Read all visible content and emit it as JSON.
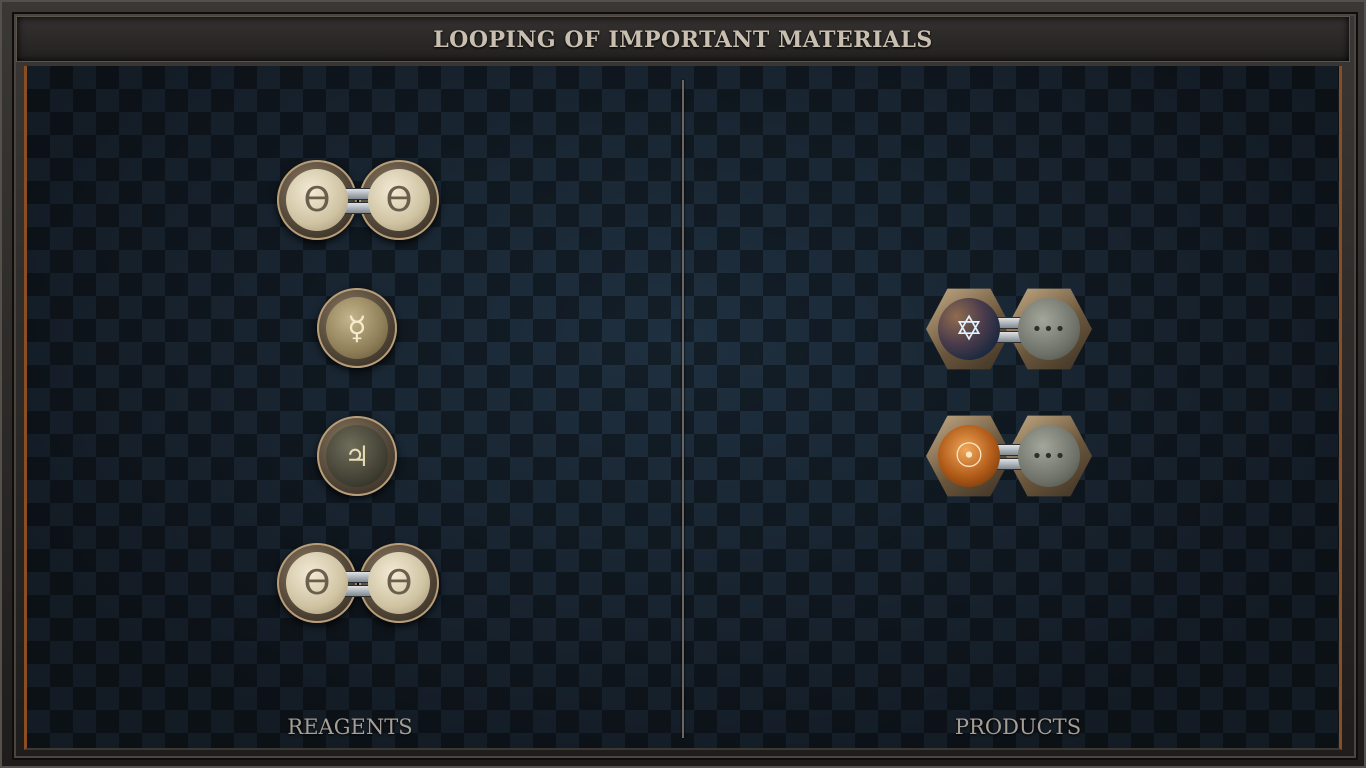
{
  "title": "LOOPING OF IMPORTANT MATERIALS",
  "columns": {
    "reagents_label": "REAGENTS",
    "products_label": "PRODUCTS"
  },
  "reagents": [
    {
      "type": "bonded-pair",
      "left_symbol": "ϴ",
      "right_symbol": "ϴ",
      "icon_names": [
        "salt-icon",
        "salt-icon"
      ]
    },
    {
      "type": "single",
      "symbol": "☿",
      "icon_name": "quicksilver-icon"
    },
    {
      "type": "single",
      "symbol": "♃",
      "icon_name": "jupiter-icon"
    },
    {
      "type": "bonded-pair",
      "left_symbol": "ϴ",
      "right_symbol": "ϴ",
      "icon_names": [
        "salt-icon",
        "salt-icon"
      ]
    }
  ],
  "products": [
    {
      "type": "bonded-pair",
      "left_symbol": "✡",
      "right_symbol": "•••",
      "icon_names": [
        "hexagram-icon",
        "ellipsis-icon"
      ]
    },
    {
      "type": "bonded-pair",
      "left_symbol": "☉",
      "right_symbol": "•••",
      "icon_names": [
        "sun-icon",
        "ellipsis-icon"
      ]
    }
  ],
  "colors": {
    "board_base": "#16212c",
    "accent_copper": "#8a4e22",
    "title_text": "#c8bfb0"
  }
}
